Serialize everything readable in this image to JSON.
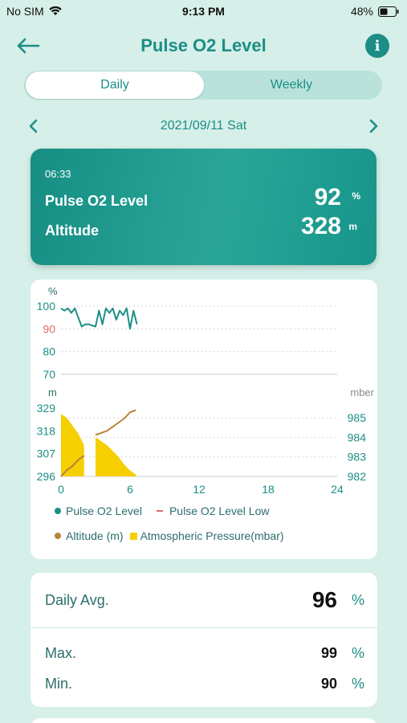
{
  "status_bar": {
    "carrier": "No SIM",
    "time": "9:13 PM",
    "battery": "48%"
  },
  "nav": {
    "title": "Pulse O2 Level",
    "back_icon": "arrow-left-icon",
    "info_icon": "info-icon",
    "info_glyph": "i"
  },
  "tabs": [
    {
      "label": "Daily",
      "selected": true
    },
    {
      "label": "Weekly",
      "selected": false
    }
  ],
  "date": {
    "text": "2021/09/11 Sat"
  },
  "summary": {
    "time": "06:33",
    "pulse_label": "Pulse O2 Level",
    "pulse_value": "92",
    "pulse_unit": "%",
    "altitude_label": "Altitude",
    "altitude_value": "328",
    "altitude_unit": "m"
  },
  "chart_data": [
    {
      "type": "line",
      "ylabel": "%",
      "ylim": [
        70,
        100
      ],
      "yticks": [
        "100",
        "90",
        "80",
        "70"
      ],
      "low_threshold": 90,
      "x": [
        0,
        0.3,
        0.6,
        0.9,
        1.2,
        1.5,
        1.8,
        2.1,
        2.4,
        3.0,
        3.3,
        3.6,
        3.9,
        4.2,
        4.5,
        4.8,
        5.1,
        5.4,
        5.7,
        6.0,
        6.3,
        6.6
      ],
      "series": [
        {
          "name": "Pulse O2 Level",
          "color": "#1c8e86",
          "values": [
            99,
            98,
            99,
            97,
            99,
            95,
            91,
            92,
            92,
            91,
            98,
            92,
            99,
            97,
            99,
            94,
            98,
            96,
            99,
            90,
            98,
            92
          ]
        }
      ]
    },
    {
      "type": "area",
      "ylabel": "m",
      "y2label": "mber",
      "xlim": [
        0,
        24
      ],
      "xticks": [
        "0",
        "6",
        "12",
        "18",
        "24"
      ],
      "ylim": [
        296,
        329
      ],
      "yticks": [
        "329",
        "318",
        "307",
        "296"
      ],
      "y2lim": [
        982,
        985.5
      ],
      "y2ticks": [
        "985",
        "984",
        "983",
        "982"
      ],
      "x": [
        0,
        0.5,
        1.0,
        1.5,
        2.0,
        2.5,
        3.0,
        3.5,
        4.0,
        4.5,
        5.0,
        5.5,
        6.0,
        6.5
      ],
      "series": [
        {
          "name": "Altitude (m)",
          "color": "#b9833a",
          "values": [
            296,
            299,
            301,
            304,
            306,
            null,
            316,
            317,
            318,
            320,
            322,
            324,
            327,
            328
          ]
        },
        {
          "name": "Atmospheric Pressure(mbar)",
          "color": "#f5cf00",
          "values": [
            985.2,
            985.0,
            984.6,
            984.2,
            983.6,
            null,
            984.0,
            983.8,
            983.6,
            983.3,
            983.0,
            982.6,
            982.3,
            982.1
          ]
        }
      ]
    }
  ],
  "legend": [
    {
      "label": "Pulse O2 Level",
      "marker": "dot",
      "color": "#1c8e86"
    },
    {
      "label": "Pulse O2 Level Low",
      "marker": "dash",
      "color": "#e36a6a"
    },
    {
      "label": "Altitude (m)",
      "marker": "dot",
      "color": "#b9833a"
    },
    {
      "label": "Atmospheric Pressure(mbar)",
      "marker": "square",
      "color": "#f5cf00"
    }
  ],
  "stats": {
    "avg_label": "Daily Avg.",
    "avg_value": "96",
    "avg_unit": "%",
    "max_label": "Max.",
    "max_value": "99",
    "max_unit": "%",
    "min_label": "Min.",
    "min_value": "90",
    "min_unit": "%"
  },
  "colors": {
    "accent": "#1c8e86",
    "low": "#e36a6a",
    "background": "#d6efe9"
  }
}
